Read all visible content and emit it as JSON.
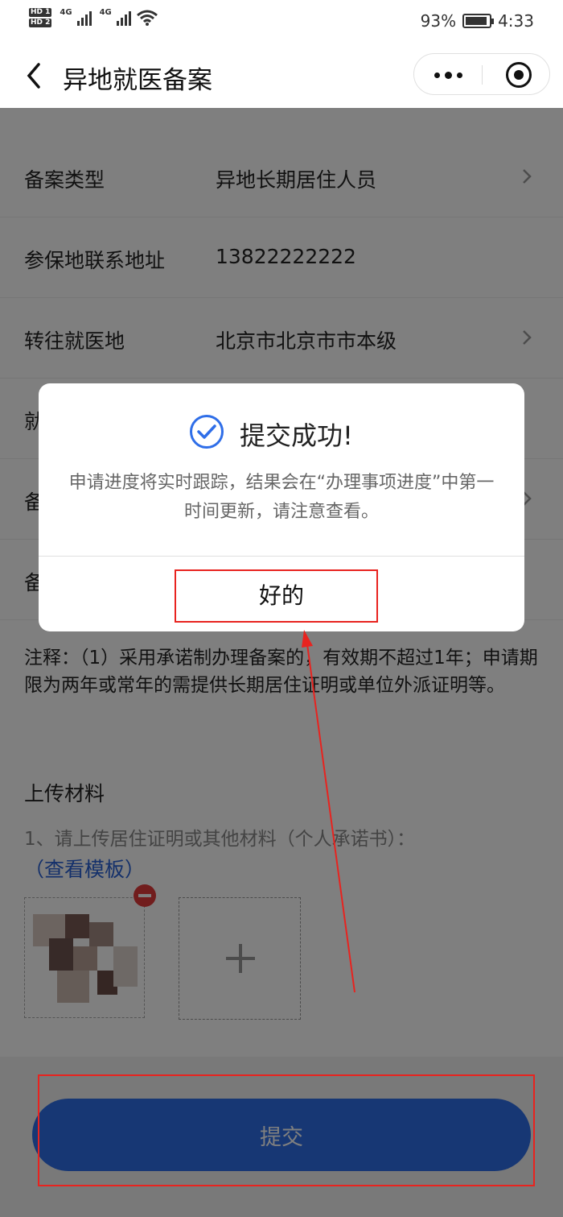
{
  "status_bar": {
    "hd1": "HD 1",
    "hd2": "HD 2",
    "net1": "4G",
    "net2": "4G",
    "battery_percent": "93%",
    "battery_level": 0.93,
    "time": "4:33"
  },
  "nav": {
    "title": "异地就医备案"
  },
  "form": {
    "rows": [
      {
        "label": "备案类型",
        "value": "异地长期居住人员",
        "chevron": true
      },
      {
        "label": "参保地联系地址",
        "value": "13822222222",
        "chevron": false
      },
      {
        "label": "转往就医地",
        "value": "北京市北京市市本级",
        "chevron": true
      },
      {
        "label": "就",
        "value": "",
        "chevron": false
      },
      {
        "label": "备",
        "value": "",
        "chevron": true
      },
      {
        "label": "备",
        "value": "",
        "chevron": false
      }
    ]
  },
  "note": "注释：（1）采用承诺制办理备案的，有效期不超过1年；申请期限为两年或常年的需提供长期居住证明或单位外派证明等。",
  "upload": {
    "title": "上传材料",
    "desc": "1、请上传居住证明或其他材料（个人承诺书）：",
    "template_link": "（查看模板）"
  },
  "submit": {
    "label": "提交"
  },
  "modal": {
    "title": "提交成功!",
    "message": "申请进度将实时跟踪，结果会在“办理事项进度”中第一时间更新，请注意查看。",
    "ok_label": "好的"
  },
  "colors": {
    "accent": "#2f6ee8",
    "link": "#2a62d6",
    "annotation": "#e8231f",
    "remove": "#e23b3b"
  }
}
